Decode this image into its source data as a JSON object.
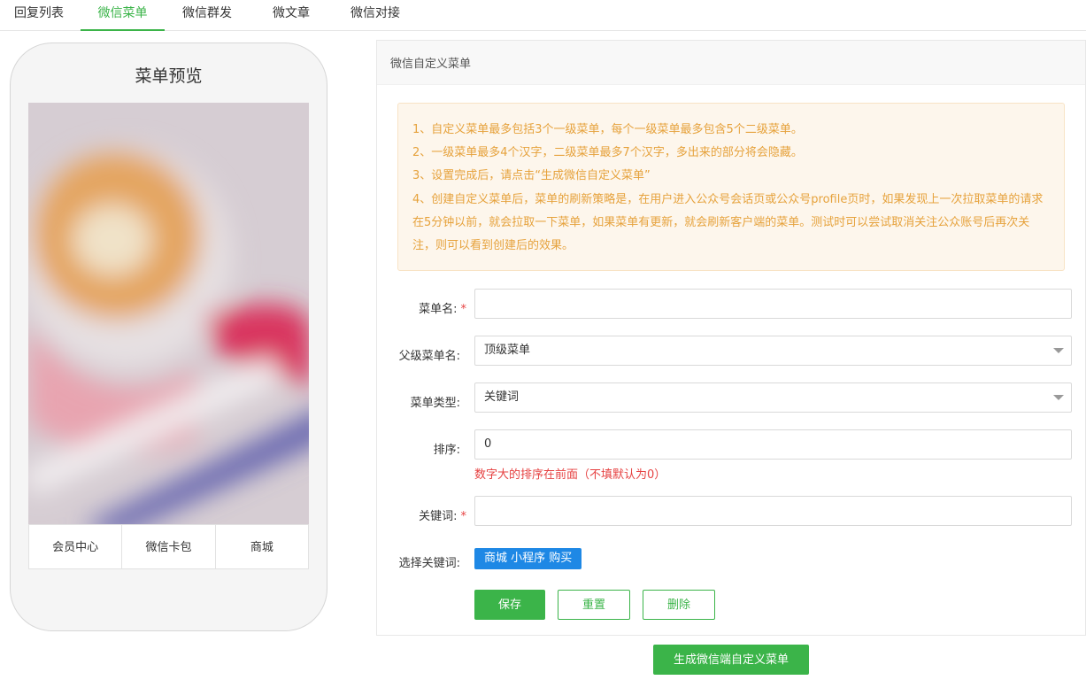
{
  "tabs": [
    {
      "label": "回复列表",
      "active": false
    },
    {
      "label": "微信菜单",
      "active": true
    },
    {
      "label": "微信群发",
      "active": false
    },
    {
      "label": "微文章",
      "active": false
    },
    {
      "label": "微信对接",
      "active": false
    }
  ],
  "preview": {
    "title": "菜单预览",
    "menu_items": [
      "会员中心",
      "微信卡包",
      "商城"
    ]
  },
  "panel": {
    "title": "微信自定义菜单",
    "notice": [
      "1、自定义菜单最多包括3个一级菜单，每个一级菜单最多包含5个二级菜单。",
      "2、一级菜单最多4个汉字，二级菜单最多7个汉字，多出来的部分将会隐藏。",
      "3、设置完成后，请点击“生成微信自定义菜单”",
      "4、创建自定义菜单后，菜单的刷新策略是，在用户进入公众号会话页或公众号profile页时，如果发现上一次拉取菜单的请求在5分钟以前，就会拉取一下菜单，如果菜单有更新，就会刷新客户端的菜单。测试时可以尝试取消关注公众账号后再次关注，则可以看到创建后的效果。"
    ]
  },
  "form": {
    "menu_name_label": "菜单名:",
    "menu_name_value": "",
    "parent_label": "父级菜单名:",
    "parent_value": "顶级菜单",
    "type_label": "菜单类型:",
    "type_value": "关键词",
    "sort_label": "排序:",
    "sort_value": "0",
    "sort_hint": "数字大的排序在前面（不填默认为0）",
    "keyword_label": "关键词:",
    "keyword_value": "",
    "choose_keyword_label": "选择关键词:",
    "keyword_tag": "商城 小程序 购买",
    "required_mark": "*"
  },
  "buttons": {
    "save": "保存",
    "reset": "重置",
    "delete": "删除",
    "generate": "生成微信端自定义菜单"
  },
  "colors": {
    "accent": "#3bb449",
    "notice_text": "#e6a23c",
    "error": "#e64242",
    "tag": "#1e88e5"
  }
}
